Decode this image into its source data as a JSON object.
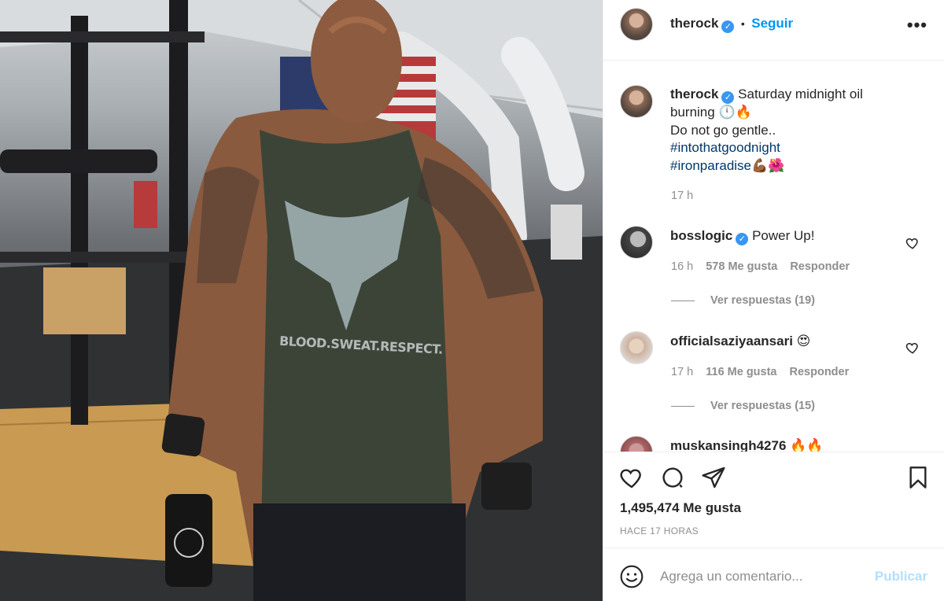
{
  "post": {
    "author": "therock",
    "follow_label": "Seguir",
    "separator": "•",
    "more_icon": "more-options-icon",
    "photo_wordmark": "BLOOD.SWEAT.RESPECT."
  },
  "caption": {
    "username": "therock",
    "line1": "Saturday midnight oil burning",
    "emojis1": "🕛🔥",
    "line2": "Do not go gentle..",
    "hashtag1": "#intothatgoodnight",
    "hashtag2": "#ironparadise",
    "emojis2": "💪🏾🌺",
    "time": "17 h"
  },
  "comments": [
    {
      "username": "bosslogic",
      "verified": true,
      "text": "Power Up!",
      "time": "16 h",
      "likes": "578 Me gusta",
      "reply": "Responder",
      "view_replies": "Ver respuestas (19)"
    },
    {
      "username": "officialsaziyaansari",
      "verified": false,
      "text": "😍",
      "time": "17 h",
      "likes": "116 Me gusta",
      "reply": "Responder",
      "view_replies": "Ver respuestas (15)"
    },
    {
      "username": "muskansingh4276",
      "verified": false,
      "text": "🔥🔥"
    }
  ],
  "actions": {
    "like_count": "1,495,474 Me gusta",
    "time_ago": "HACE 17 HORAS"
  },
  "comment_box": {
    "placeholder": "Agrega un comentario...",
    "publish_label": "Publicar"
  },
  "colors": {
    "accent": "#0095f6",
    "verified": "#3897f0",
    "hashtag": "#00376b",
    "muted": "#8e8e8e",
    "publish_disabled": "#b2dffc"
  }
}
